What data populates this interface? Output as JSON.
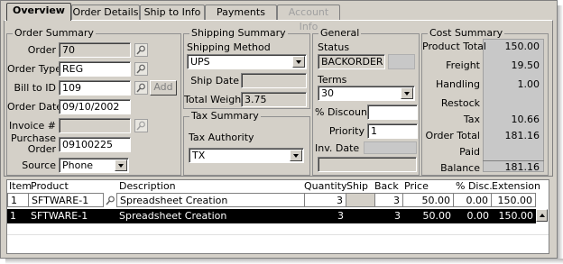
{
  "tabs": [
    "Overview",
    "Order Details",
    "Ship to Info",
    "Payments",
    "Account Info"
  ],
  "order_summary": {
    "title": "Order Summary",
    "order_label": "Order",
    "order_value": "70",
    "order_type_label": "Order Type",
    "order_type_value": "REG",
    "bill_to_label": "Bill to ID",
    "bill_to_value": "109",
    "add_label": "Add",
    "order_date_label": "Order Date",
    "order_date_value": "09/10/2002",
    "invoice_label": "Invoice #",
    "invoice_value": "",
    "po_label_1": "Purchase",
    "po_label_2": "Order",
    "po_value": "09100225",
    "source_label": "Source",
    "source_value": "Phone"
  },
  "shipping_summary": {
    "title": "Shipping Summary",
    "method_label": "Shipping Method",
    "method_value": "UPS",
    "ship_date_label": "Ship Date",
    "ship_date_value": "",
    "weight_label": "Total Weight",
    "weight_value": "3.75"
  },
  "tax_summary": {
    "title": "Tax Summary",
    "authority_label": "Tax Authority",
    "authority_value": "TX"
  },
  "general": {
    "title": "General",
    "status_label": "Status",
    "status_value": "BACKORDER",
    "terms_label": "Terms",
    "terms_value": "30",
    "discount_label": "% Discount",
    "discount_value": "",
    "priority_label": "Priority",
    "priority_value": "1",
    "inv_date_label": "Inv. Date",
    "inv_date_value": ""
  },
  "cost_summary": {
    "title": "Cost Summary",
    "product_total_label": "Product Total",
    "product_total_value": "150.00",
    "freight_label": "Freight",
    "freight_value": "19.50",
    "handling_label": "Handling",
    "handling_value": "1.00",
    "restock_label": "Restock",
    "restock_value": "",
    "tax_label": "Tax",
    "tax_value": "10.66",
    "order_total_label": "Order Total",
    "order_total_value": "181.16",
    "paid_label": "Paid",
    "paid_value": "",
    "balance_label": "Balance",
    "balance_value": "181.16"
  },
  "grid": {
    "headers": {
      "item": "Item",
      "product": "Product",
      "description": "Description",
      "quantity": "Quantity",
      "ship": "Ship",
      "back": "Back",
      "price": "Price",
      "disc": "% Disc.",
      "extension": "Extension"
    },
    "rows": [
      {
        "item": "1",
        "product": "SFTWARE-1",
        "description": "Spreadsheet Creation",
        "quantity": "3",
        "ship": "",
        "back": "3",
        "price": "50.00",
        "disc": "0.00",
        "extension": "150.00"
      },
      {
        "item": "1",
        "product": "SFTWARE-1",
        "description": "Spreadsheet Creation",
        "quantity": "3",
        "ship": "",
        "back": "3",
        "price": "50.00",
        "disc": "0.00",
        "extension": "150.00"
      }
    ]
  },
  "icons": {
    "lookup": "magnifier-icon",
    "dropdown": "chevron-down-icon",
    "scroll_up": "arrow-up-icon"
  }
}
